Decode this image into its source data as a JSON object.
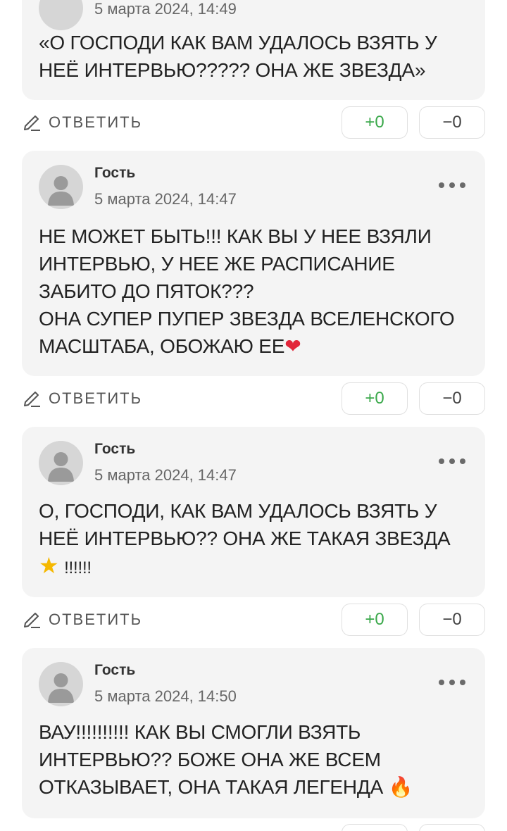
{
  "ui": {
    "reply_label": "ОТВЕТИТЬ"
  },
  "comments": [
    {
      "date": "5 марта 2024, 14:49",
      "text": "«О ГОСПОДИ КАК ВАМ УДАЛОСЬ ВЗЯТЬ У\nНЕЁ ИНТЕРВЬЮ????? ОНА ЖЕ ЗВЕЗДА»",
      "up": "+0",
      "down": "−0"
    },
    {
      "author": "Гость",
      "date": "5 марта 2024, 14:47",
      "text": "НЕ МОЖЕТ БЫТЬ!!! КАК ВЫ У НЕЕ ВЗЯЛИ\nИНТЕРВЬЮ, У НЕЕ ЖЕ РАСПИСАНИЕ\nЗАБИТО ДО ПЯТОК???\nОНА СУПЕР ПУПЕР ЗВЕЗДА ВСЕЛЕНСКОГО\nМАСШТАБА, ОБОЖАЮ ЕЕ",
      "emoji": "❤",
      "up": "+0",
      "down": "−0"
    },
    {
      "author": "Гость",
      "date": "5 марта 2024, 14:47",
      "text": "О, ГОСПОДИ, КАК ВАМ УДАЛОСЬ ВЗЯТЬ У\nНЕЁ ИНТЕРВЬЮ?? ОНА ЖЕ ТАКАЯ ЗВЕЗДА",
      "emoji": "★",
      "tail": "!!!!!!",
      "up": "+0",
      "down": "−0"
    },
    {
      "author": "Гость",
      "date": "5 марта 2024, 14:50",
      "text": "ВАУ!!!!!!!!!! КАК ВЫ СМОГЛИ ВЗЯТЬ\nИНТЕРВЬЮ?? БОЖЕ ОНА ЖЕ ВСЕМ\nОТКАЗЫВАЕТ, ОНА ТАКАЯ ЛЕГЕНДА",
      "emoji": "🔥"
    }
  ]
}
